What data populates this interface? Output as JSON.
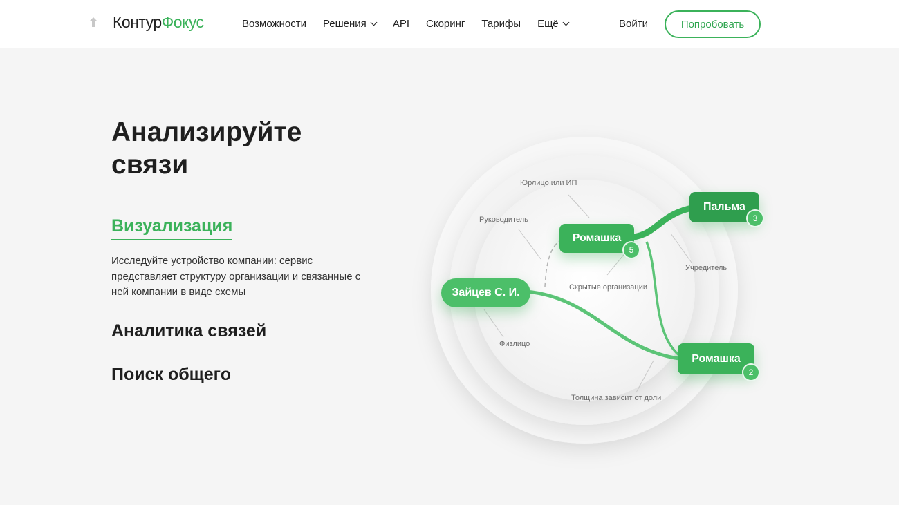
{
  "header": {
    "logo_part1": "Контур",
    "logo_part2": "Фокус",
    "nav": [
      {
        "label": "Возможности",
        "dropdown": false
      },
      {
        "label": "Решения",
        "dropdown": true
      },
      {
        "label": "API",
        "dropdown": false
      },
      {
        "label": "Скоринг",
        "dropdown": false
      },
      {
        "label": "Тарифы",
        "dropdown": false
      },
      {
        "label": "Ещё",
        "dropdown": true
      }
    ],
    "login": "Войти",
    "cta": "Попробовать"
  },
  "section": {
    "title": "Анализируйте связи",
    "tabs": [
      {
        "label": "Визуализация",
        "active": true
      },
      {
        "label": "Аналитика связей",
        "active": false
      },
      {
        "label": "Поиск общего",
        "active": false
      }
    ],
    "description": "Исследуйте устройство компании: сервис представляет структуру организации и связанные с ней компании в виде схемы"
  },
  "diagram": {
    "nodes": {
      "romashka_top": {
        "label": "Ромашка",
        "badge": "5"
      },
      "palma": {
        "label": "Пальма",
        "badge": "3"
      },
      "zaytsev": {
        "label": "Зайцев С. И."
      },
      "romashka_bottom": {
        "label": "Ромашка",
        "badge": "2"
      }
    },
    "labels": {
      "legal": "Юрлицо или ИП",
      "head": "Руководитель",
      "founder": "Учредитель",
      "hidden": "Скрытые организации",
      "person": "Физлицо",
      "thickness": "Толщина зависит от доли"
    }
  },
  "colors": {
    "accent": "#3bb25a",
    "background": "#f5f5f5"
  }
}
